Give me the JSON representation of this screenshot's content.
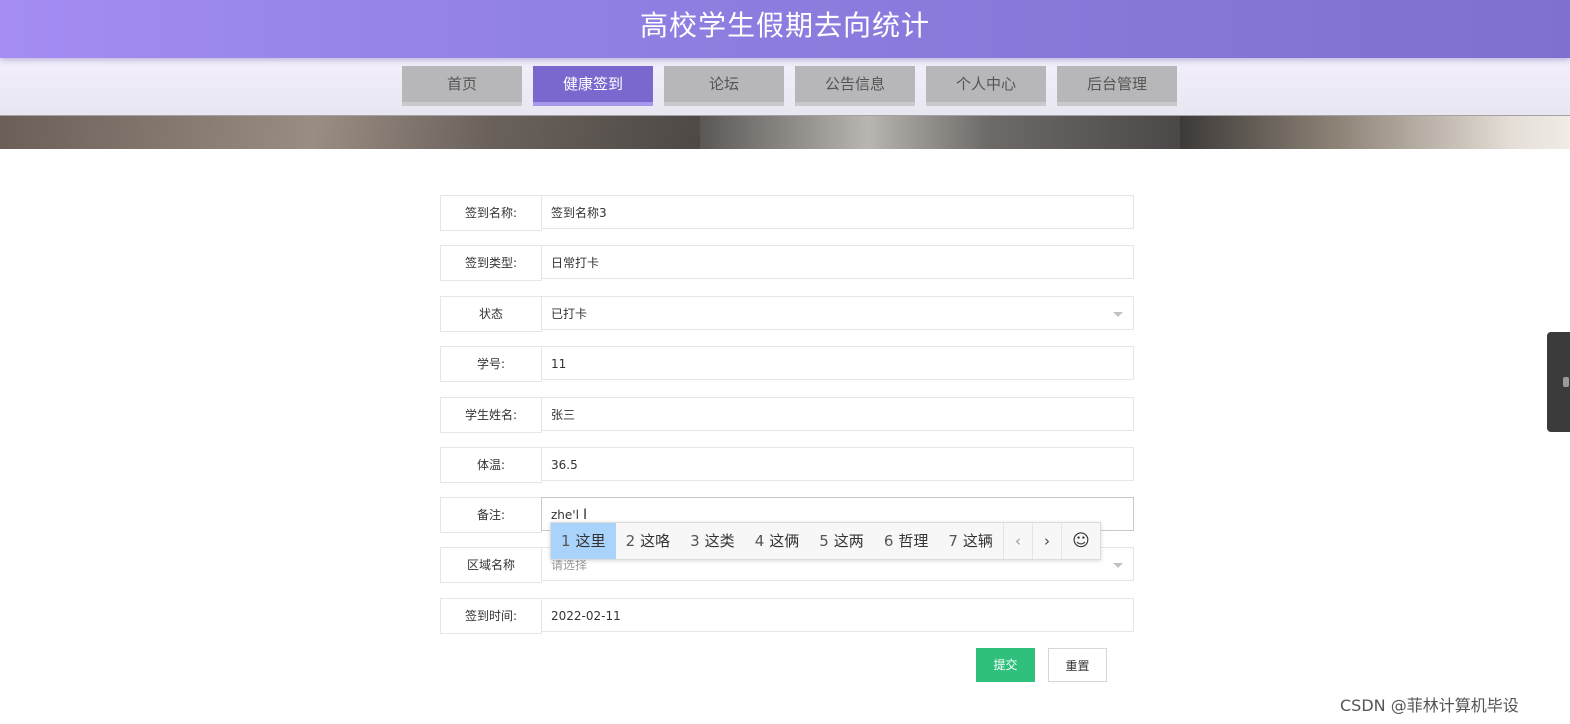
{
  "header": {
    "title": "高校学生假期去向统计"
  },
  "nav": {
    "items": [
      {
        "label": "首页",
        "active": false
      },
      {
        "label": "健康签到",
        "active": true
      },
      {
        "label": "论坛",
        "active": false
      },
      {
        "label": "公告信息",
        "active": false
      },
      {
        "label": "个人中心",
        "active": false
      },
      {
        "label": "后台管理",
        "active": false
      }
    ]
  },
  "form": {
    "fields": [
      {
        "label": "签到名称:",
        "value": "签到名称3",
        "type": "text"
      },
      {
        "label": "签到类型:",
        "value": "日常打卡",
        "type": "text"
      },
      {
        "label": "状态",
        "value": "已打卡",
        "type": "select"
      },
      {
        "label": "学号:",
        "value": "11",
        "type": "text"
      },
      {
        "label": "学生姓名:",
        "value": "张三",
        "type": "text"
      },
      {
        "label": "体温:",
        "value": "36.5",
        "type": "text"
      },
      {
        "label": "备注:",
        "value": "zhe'l",
        "type": "text"
      },
      {
        "label": "区域名称",
        "placeholder": "请选择",
        "type": "select"
      },
      {
        "label": "签到时间:",
        "value": "2022-02-11",
        "type": "text"
      }
    ],
    "submit_label": "提交",
    "reset_label": "重置"
  },
  "ime": {
    "candidates": [
      {
        "num": "1",
        "text": "这里"
      },
      {
        "num": "2",
        "text": "这咯"
      },
      {
        "num": "3",
        "text": "这类"
      },
      {
        "num": "4",
        "text": "这俩"
      },
      {
        "num": "5",
        "text": "这两"
      },
      {
        "num": "6",
        "text": "哲理"
      },
      {
        "num": "7",
        "text": "这辆"
      }
    ],
    "prev": "‹",
    "next": "›",
    "emoji": "☺"
  },
  "watermark": "CSDN @菲林计算机毕设",
  "colors": {
    "header": "#8f7fe2",
    "nav_active": "#7a68cf",
    "submit": "#2fc17c"
  }
}
